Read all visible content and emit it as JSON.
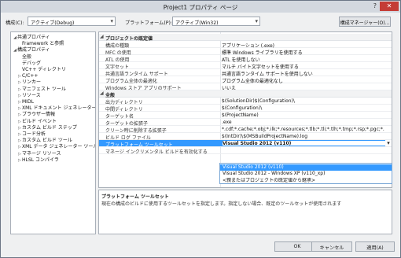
{
  "window": {
    "title": "Project1 プロパティ ページ",
    "help": "?",
    "close": "✕"
  },
  "topbar": {
    "config_label": "構成(C):",
    "config_value": "アクティブ(Debug)",
    "platform_label": "プラットフォーム(P):",
    "platform_value": "アクティブ(Win32)",
    "manager_button": "構成マネージャー(O)..."
  },
  "tree": [
    {
      "toggle": "◢",
      "label": "共通プロパティ",
      "level": 0
    },
    {
      "toggle": "",
      "label": "Framework と参照",
      "level": 1
    },
    {
      "toggle": "◢",
      "label": "構成プロパティ",
      "level": 0
    },
    {
      "toggle": "",
      "label": "全般",
      "level": 1
    },
    {
      "toggle": "",
      "label": "デバッグ",
      "level": 1
    },
    {
      "toggle": "",
      "label": "VC++ ディレクトリ",
      "level": 1
    },
    {
      "toggle": "▷",
      "label": "C/C++",
      "level": 1
    },
    {
      "toggle": "▷",
      "label": "リンカー",
      "level": 1
    },
    {
      "toggle": "▷",
      "label": "マニフェスト ツール",
      "level": 1
    },
    {
      "toggle": "▷",
      "label": "リソース",
      "level": 1
    },
    {
      "toggle": "▷",
      "label": "MIDL",
      "level": 1
    },
    {
      "toggle": "▷",
      "label": "XML ドキュメント ジェネレーター",
      "level": 1
    },
    {
      "toggle": "▷",
      "label": "ブラウザー情報",
      "level": 1
    },
    {
      "toggle": "▷",
      "label": "ビルド イベント",
      "level": 1
    },
    {
      "toggle": "▷",
      "label": "カスタム ビルド ステップ",
      "level": 1
    },
    {
      "toggle": "▷",
      "label": "コード分析",
      "level": 1
    },
    {
      "toggle": "▷",
      "label": "カスタム ビルド ツール",
      "level": 1
    },
    {
      "toggle": "▷",
      "label": "XML データ ジェネレーター ツール",
      "level": 1
    },
    {
      "toggle": "▷",
      "label": "マネージ リソース",
      "level": 1
    },
    {
      "toggle": "▷",
      "label": "HLSL コンパイラ",
      "level": 1
    }
  ],
  "grid": {
    "sections": [
      {
        "name": "プロジェクトの既定値",
        "rows": [
          {
            "name": "構成の種類",
            "value": "アプリケーション (.exe)"
          },
          {
            "name": "MFC の使用",
            "value": "標準 Windows ライブラリを使用する"
          },
          {
            "name": "ATL の使用",
            "value": "ATL を使用しない"
          },
          {
            "name": "文字セット",
            "value": "マルチ バイト文字セットを使用する"
          },
          {
            "name": "共通言語ランタイム サポート",
            "value": "共通言語ランタイム サポートを使用しない"
          },
          {
            "name": "プログラム全体の最適化",
            "value": "プログラム全体の最適化なし"
          },
          {
            "name": "Windows ストア アプリのサポート",
            "value": "いいえ"
          }
        ]
      },
      {
        "name": "全般",
        "rows": [
          {
            "name": "出力ディレクトリ",
            "value": "$(SolutionDir)$(Configuration)\\"
          },
          {
            "name": "中間ディレクトリ",
            "value": "$(Configuration)\\"
          },
          {
            "name": "ターゲット名",
            "value": "$(ProjectName)"
          },
          {
            "name": "ターゲットの拡張子",
            "value": ".exe"
          },
          {
            "name": "クリーン時に削除する拡張子",
            "value": "*.cdf;*.cache;*.obj;*.ilk;*.resources;*.tlb;*.tli;*.tlh;*.tmp;*.rsp;*.pgc;*."
          },
          {
            "name": "ビルド ログ ファイル",
            "value": "$(IntDir)\\$(MSBuildProjectName).log"
          },
          {
            "name": "プラットフォーム ツールセット",
            "value": "Visual Studio 2012 (v110)",
            "selected": true
          },
          {
            "name": "マネージ インクリメンタル ビルドを有効化する",
            "value": ""
          }
        ]
      }
    ]
  },
  "dropdown": {
    "options": [
      "Visual Studio 2012 (v110)",
      "Visual Studio 2012 - Windows XP (v110_xp)",
      "<親またはプロジェクトの既定値から継承>"
    ],
    "highlighted": 0
  },
  "description": {
    "title": "プラットフォーム ツールセット",
    "text": "現在の構成のビルドに使用するツールセットを指定します。指定しない場合、既定のツールセットが使用されます"
  },
  "buttons": {
    "ok": "OK",
    "cancel": "キャンセル",
    "apply": "適用(A)"
  }
}
